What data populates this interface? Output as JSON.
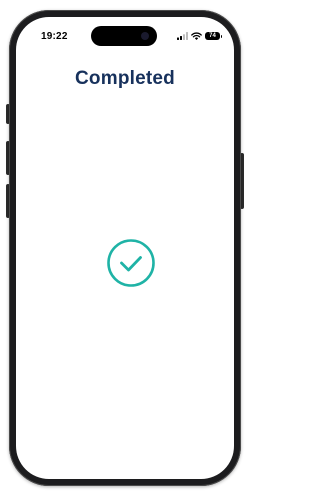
{
  "status_bar": {
    "time": "19:22",
    "battery_level": "74",
    "signal_icon": "cellular-signal-icon",
    "wifi_icon": "wifi-icon",
    "battery_icon": "battery-icon"
  },
  "screen": {
    "title": "Completed",
    "status_icon": "checkmark-circle-icon"
  },
  "colors": {
    "title": "#17315c",
    "accent": "#1fb3a6",
    "frame": "#1c1c1e"
  }
}
